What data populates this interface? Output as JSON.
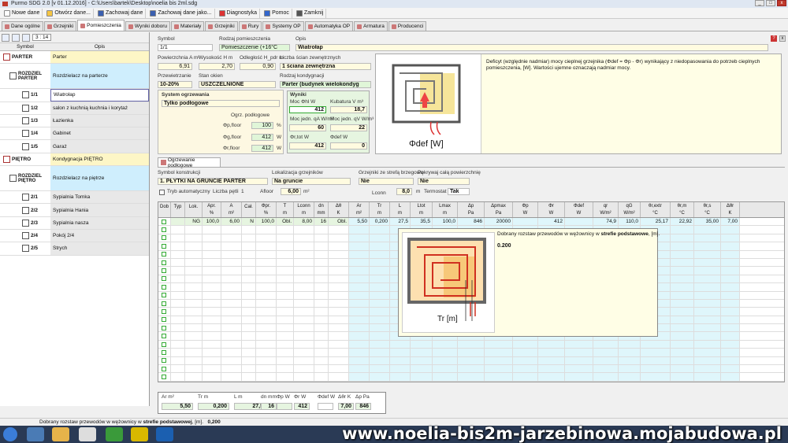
{
  "window": {
    "title": "Purmo SDG 2.0  [v 01.12.2016] - C:\\Users\\bartek\\Desktop\\noelia bis 2ml.sdg"
  },
  "menu": [
    {
      "label": "Nowe dane",
      "icon": "new-file-icon",
      "color": "#ffffff"
    },
    {
      "label": "Otwórz dane...",
      "icon": "open-folder-icon",
      "color": "#f5c542"
    },
    {
      "label": "Zachowaj dane",
      "icon": "save-icon",
      "color": "#3a5fb0"
    },
    {
      "label": "Zachowaj dane jako...",
      "icon": "save-as-icon",
      "color": "#3a5fb0"
    },
    {
      "label": "Diagnostyka",
      "icon": "diagnostics-icon",
      "color": "#d33"
    },
    {
      "label": "Pomoc",
      "icon": "help-icon",
      "color": "#36c"
    },
    {
      "label": "Zamknij",
      "icon": "close-program-icon",
      "color": "#555"
    }
  ],
  "tabs": [
    {
      "label": "Dane ogólne",
      "active": false
    },
    {
      "label": "Grzejniki",
      "active": false
    },
    {
      "label": "Pomieszczenia",
      "active": true
    },
    {
      "label": "Wyniki doboru",
      "active": false
    },
    {
      "label": "Materiały",
      "active": false
    },
    {
      "label": "Grzejniki",
      "active": false
    },
    {
      "label": "Rury",
      "active": false
    },
    {
      "label": "Systemy OP",
      "active": false
    },
    {
      "label": "Automatyka OP",
      "active": false
    },
    {
      "label": "Armatura",
      "active": false
    },
    {
      "label": "Producenci",
      "active": false
    }
  ],
  "left": {
    "counter": "3 : 14",
    "col_symbol": "Symbol",
    "col_opis": "Opis",
    "tree": [
      {
        "type": "floor",
        "symbol": "PARTER",
        "desc": "Parter"
      },
      {
        "type": "dist",
        "symbol": "ROZDZIEL PARTER",
        "desc": "Rozdzielacz na parterze"
      },
      {
        "type": "room",
        "symbol": "1/1",
        "desc": "Wiatrołap",
        "selected": true
      },
      {
        "type": "room",
        "symbol": "1/2",
        "desc": "salon z kuchnią kuchnia i korytaż"
      },
      {
        "type": "room",
        "symbol": "1/3",
        "desc": "Łazienka"
      },
      {
        "type": "room",
        "symbol": "1/4",
        "desc": "Gabinet"
      },
      {
        "type": "room",
        "symbol": "1/5",
        "desc": "Garaż"
      },
      {
        "type": "floor",
        "symbol": "PIĘTRO",
        "desc": "Kondygnacja PIĘTRO"
      },
      {
        "type": "dist",
        "symbol": "ROZDZIEL PIĘTRO",
        "desc": "Rozdzielacz na piętrze"
      },
      {
        "type": "room",
        "symbol": "2/1",
        "desc": "Sypialnia Tomka"
      },
      {
        "type": "room",
        "symbol": "2/2",
        "desc": "Sypialnia Hania"
      },
      {
        "type": "room",
        "symbol": "2/3",
        "desc": "Sypialnia nasza"
      },
      {
        "type": "room",
        "symbol": "2/4",
        "desc": "Pokój 2/4"
      },
      {
        "type": "room",
        "symbol": "2/5",
        "desc": "Strych"
      }
    ]
  },
  "room": {
    "l_symbol": "Symbol",
    "symbol": "1/1",
    "l_rodzaj": "Rodzaj pomieszczenia",
    "rodzaj": "Pomieszczenie (+16°C",
    "l_opis": "Opis",
    "opis": "Wiatrołap",
    "l_pow": "Powierzchnia A m²",
    "pow": "6,91",
    "l_wys": "Wysokość H m",
    "wys": "2,70",
    "l_odl": "Odległość H_pdr m",
    "odl": "0,90",
    "l_sciany": "Liczba ścian zewnętrznych",
    "sciany": "1 ściana zewnętrzna",
    "l_przew": "Przewietrzanie",
    "przew": "10-20%",
    "l_stan": "Stan okien",
    "stan": "USZCZELNIONE",
    "l_kond": "Rodzaj kondygnacji",
    "kond": "Parter (budynek wielokondyg",
    "l_sys": "System ogrzewania",
    "sys": "Tylko podłogowe",
    "l_ogrz": "Ogrz. podłogowe",
    "phi_floor_pct": "100",
    "phi_floor_pct_unit": "%",
    "phi_floor_a": "412",
    "phi_floor_b": "412",
    "unit_w": "W",
    "l_phi_p": "Φp,floor",
    "l_phi_g": "Φg,floor",
    "l_phi_f": "Φr,floor",
    "wyniki_label": "Wyniki",
    "l_moc": "Moc Φhl W",
    "moc": "412",
    "l_kub": "Kubatura V m³",
    "kub": "18,7",
    "l_mocA": "Moc jedn. qA W/m²",
    "mocA": "60",
    "l_mocV": "Moc jedn. qV W/m³",
    "mocV": "22",
    "l_phitot": "Φr,tot W",
    "phitot": "412",
    "l_phidef": "Φdef W",
    "phidef": "0",
    "defdesc": "Deficyt (względnie nadmiar) mocy cieplnej grzejnika (Φdef = Φp - Φr) wynikający z niedopasowania do potrzeb cieplnych pomieszczenia, [W]. Wartości ujemne oznaczają nadmiar mocy.",
    "defsym": "Φdef [W]"
  },
  "floorheat": {
    "subtab": "Ogrzewanie podłogowe",
    "l_konstr": "Symbol konstrukcji",
    "konstr": "1. PŁYTKI NA GRUNCIE PARTER",
    "l_lok": "Lokalizacja grzejników",
    "lok": "Na gruncie",
    "l_strefa": "Grzejniki ze strefą brzegową",
    "strefa": "Nie",
    "l_pokr": "Pokrywaj całą powierzchnię",
    "pokr": "Nie",
    "l_tryb": "Tryb automatyczny",
    "l_liczba": "Liczba pętli",
    "liczba": "1",
    "l_afloor": "Afloor",
    "afloor": "6,00",
    "afloor_unit": "m²",
    "l_lconn": "Lconn",
    "lconn": "8,0",
    "lconn_unit": "m",
    "l_term": "Termostat",
    "term": "Tak"
  },
  "grid": {
    "headers": [
      [
        "Dob",
        ""
      ],
      [
        "Typ",
        ""
      ],
      [
        "Lok.",
        ""
      ],
      [
        "Apr.",
        "%"
      ],
      [
        "A",
        "m²"
      ],
      [
        "Cał.",
        ""
      ],
      [
        "Φpr.",
        "%"
      ],
      [
        "T",
        "m"
      ],
      [
        "Lconn",
        "m"
      ],
      [
        "dn",
        "mm"
      ],
      [
        "Δθ",
        "K"
      ],
      [
        "Ar",
        "m²"
      ],
      [
        "Tr",
        "m"
      ],
      [
        "L",
        "m"
      ],
      [
        "Ltot",
        "m"
      ],
      [
        "Lmax",
        "m"
      ],
      [
        "Δp",
        "Pa"
      ],
      [
        "Δpmax",
        "Pa"
      ],
      [
        "Φp",
        "W"
      ],
      [
        "Φr",
        "W"
      ],
      [
        "Φdef",
        "W"
      ],
      [
        "qr",
        "W/m²"
      ],
      [
        "qG",
        "W/m²"
      ],
      [
        "θr,extr",
        "°C"
      ],
      [
        "θr,m",
        "°C"
      ],
      [
        "θr,s",
        "°C"
      ],
      [
        "Δθr",
        "K"
      ]
    ],
    "row": [
      "",
      "",
      "NG",
      "100,0",
      "6,00",
      "N",
      "100,0",
      "Obl.",
      "8,00",
      "16",
      "Obl.",
      "5,50",
      "0,200",
      "27,5",
      "35,5",
      "100,0",
      "846",
      "20000",
      "",
      "412",
      "",
      "74,9",
      "110,0",
      "25,17",
      "22,92",
      "35,00",
      "7,00"
    ]
  },
  "tooltip": {
    "text_a": "Dobrany rozstaw przewodów w wężownicy w",
    "text_b": "strefie podstawowe",
    "text_c": ", [m].",
    "value": "0.200",
    "sym": "Tr [m]"
  },
  "summary": {
    "h": [
      "Ar m²",
      "Tr m",
      "L m",
      "dn mm",
      "Φp W",
      "Φr W",
      "Φdef W",
      "Δθr K",
      "Δp Pa"
    ],
    "v": [
      "5,50",
      "0,200",
      "27,5",
      "16",
      "",
      "412",
      "",
      "7,00",
      "846"
    ]
  },
  "status": {
    "text_a": "Dobrany rozstaw przewodów w wężownicy w",
    "text_b": "strefie podstawowej",
    "text_c": ", [m].",
    "value": "0,200"
  },
  "watermark": "www.noelia-bis2m-jarzebinowa.mojabudowa.pl"
}
